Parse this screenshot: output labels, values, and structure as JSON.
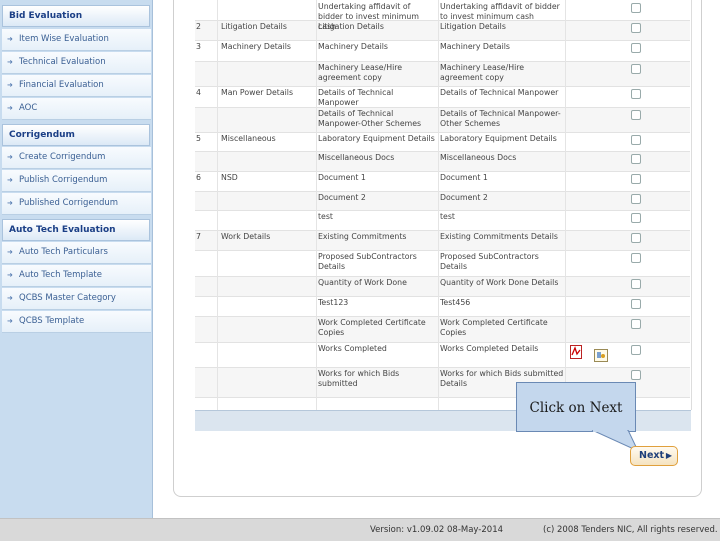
{
  "sidebar": {
    "bid_evaluation": {
      "title": "Bid Evaluation",
      "items": [
        "Item Wise Evaluation",
        "Technical Evaluation",
        "Financial Evaluation",
        "AOC"
      ]
    },
    "corrigendum": {
      "title": "Corrigendum",
      "items": [
        "Create Corrigendum",
        "Publish Corrigendum",
        "Published Corrigendum"
      ]
    },
    "auto_tech": {
      "title": "Auto Tech Evaluation",
      "items": [
        "Auto Tech Particulars",
        "Auto Tech Template",
        "QCBS Master Category",
        "QCBS Template"
      ]
    }
  },
  "table": {
    "rows": [
      {
        "sn": "",
        "category": "",
        "document": "Undertaking affidavit of bidder to invest minimum cash",
        "details": "Undertaking affidavit of bidder to invest minimum cash"
      },
      {
        "sn": "2",
        "category": "Litigation Details",
        "document": "Litigation Details",
        "details": "Litigation Details"
      },
      {
        "sn": "3",
        "category": "Machinery Details",
        "document": "Machinery Details",
        "details": "Machinery Details"
      },
      {
        "sn": "",
        "category": "",
        "document": "Machinery Lease/Hire agreement copy",
        "details": "Machinery Lease/Hire agreement copy"
      },
      {
        "sn": "4",
        "category": "Man Power Details",
        "document": "Details of Technical Manpower",
        "details": "Details of Technical Manpower"
      },
      {
        "sn": "",
        "category": "",
        "document": "Details of Technical Manpower-Other Schemes",
        "details": "Details of Technical Manpower-Other Schemes"
      },
      {
        "sn": "5",
        "category": "Miscellaneous",
        "document": "Laboratory Equipment Details",
        "details": "Laboratory Equipment Details"
      },
      {
        "sn": "",
        "category": "",
        "document": "Miscellaneous Docs",
        "details": "Miscellaneous Docs"
      },
      {
        "sn": "6",
        "category": "NSD",
        "document": "Document 1",
        "details": "Document 1"
      },
      {
        "sn": "",
        "category": "",
        "document": "Document 2",
        "details": "Document 2"
      },
      {
        "sn": "",
        "category": "",
        "document": "test",
        "details": "test"
      },
      {
        "sn": "7",
        "category": "Work Details",
        "document": "Existing Commitments",
        "details": "Existing Commitments Details"
      },
      {
        "sn": "",
        "category": "",
        "document": "Proposed SubContractors Details",
        "details": "Proposed SubContractors Details"
      },
      {
        "sn": "",
        "category": "",
        "document": "Quantity of Work Done",
        "details": "Quantity of Work Done Details"
      },
      {
        "sn": "",
        "category": "",
        "document": "Test123",
        "details": "Test456"
      },
      {
        "sn": "",
        "category": "",
        "document": "Work Completed Certificate Copies",
        "details": "Work Completed Certificate Copies"
      },
      {
        "sn": "",
        "category": "",
        "document": "Works Completed",
        "details": "Works Completed Details"
      },
      {
        "sn": "",
        "category": "",
        "document": "Works for which Bids submitted",
        "details": "Works for which Bids submitted Details"
      }
    ]
  },
  "callout": {
    "text": "Click on Next"
  },
  "next_button": {
    "label": "Next"
  },
  "footer": {
    "version": "Version: v1.09.02 08-May-2014",
    "copyright": "(c) 2008 Tenders NIC, All rights reserved."
  },
  "colors": {
    "sidebar_bg": "#c8dcef",
    "menu_text": "#3a5f93",
    "section_title": "#1b3f86",
    "next_border": "#e0a03c"
  }
}
